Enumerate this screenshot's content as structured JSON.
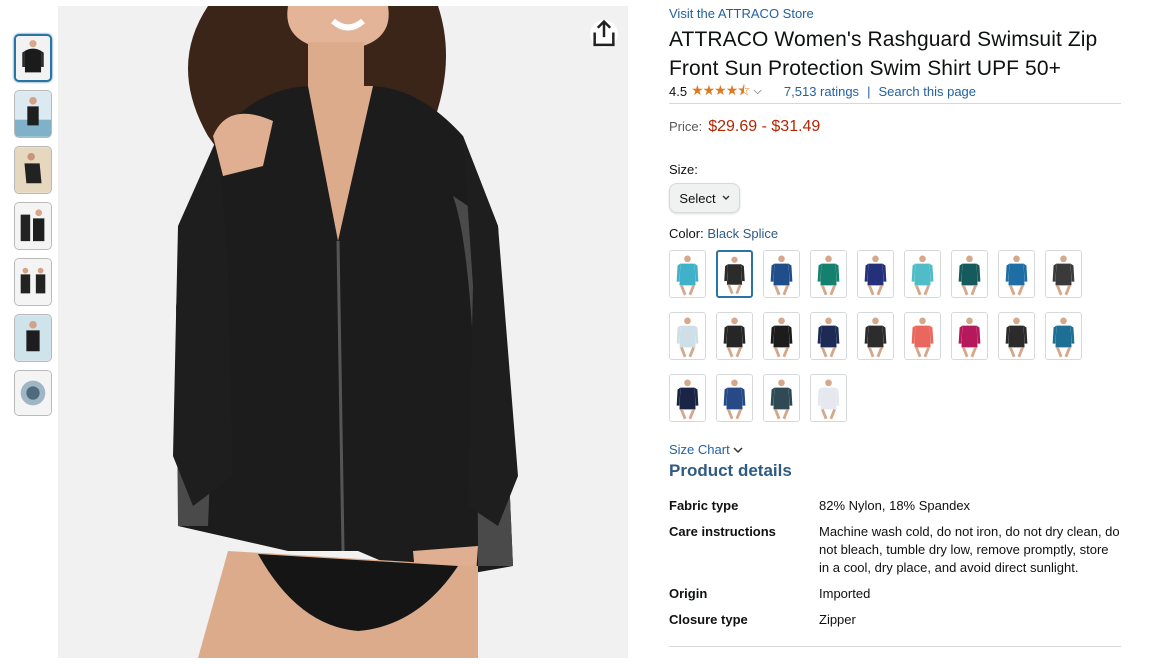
{
  "product": {
    "store_link": "Visit the ATTRACO Store",
    "title": "ATTRACO Women's Rashguard Swimsuit Zip Front Sun Protection Swim Shirt UPF 50+",
    "rating": "4.5",
    "stars": "★★★★⯪",
    "ratings_count": "7,513 ratings",
    "separator": "|",
    "search_link": "Search this page",
    "price_label": "Price:",
    "price": "$29.69 - $31.49"
  },
  "size": {
    "label": "Size:",
    "select_label": "Select"
  },
  "color": {
    "label": "Color:",
    "value": "Black Splice"
  },
  "swatch_colors": [
    "#3fb2c9",
    "#2b2b2b",
    "#1f4e8a",
    "#16806e",
    "#24307a",
    "#4fbcc8",
    "#155a5c",
    "#1e6ea6",
    "#3a3a3a",
    "#cfdfe8",
    "#262626",
    "#1c1c1c",
    "#1d2a55",
    "#2c2c2c",
    "#e9675d",
    "#b5195c",
    "#2b2b2b",
    "#1d6f95",
    "#1a2444",
    "#274a86",
    "#2f4a55",
    "#e5e8ee"
  ],
  "size_chart": "Size Chart",
  "details": {
    "title": "Product details",
    "rows": [
      {
        "key": "Fabric type",
        "value": "82% Nylon, 18% Spandex"
      },
      {
        "key": "Care instructions",
        "value": "Machine wash cold, do not iron, do not dry clean, do not bleach, tumble dry low, remove promptly, store in a cool, dry place, and avoid direct sunlight."
      },
      {
        "key": "Origin",
        "value": "Imported"
      },
      {
        "key": "Closure type",
        "value": "Zipper"
      }
    ]
  },
  "icons": {
    "share": "share-icon",
    "chevron": "chevron-down-icon"
  }
}
